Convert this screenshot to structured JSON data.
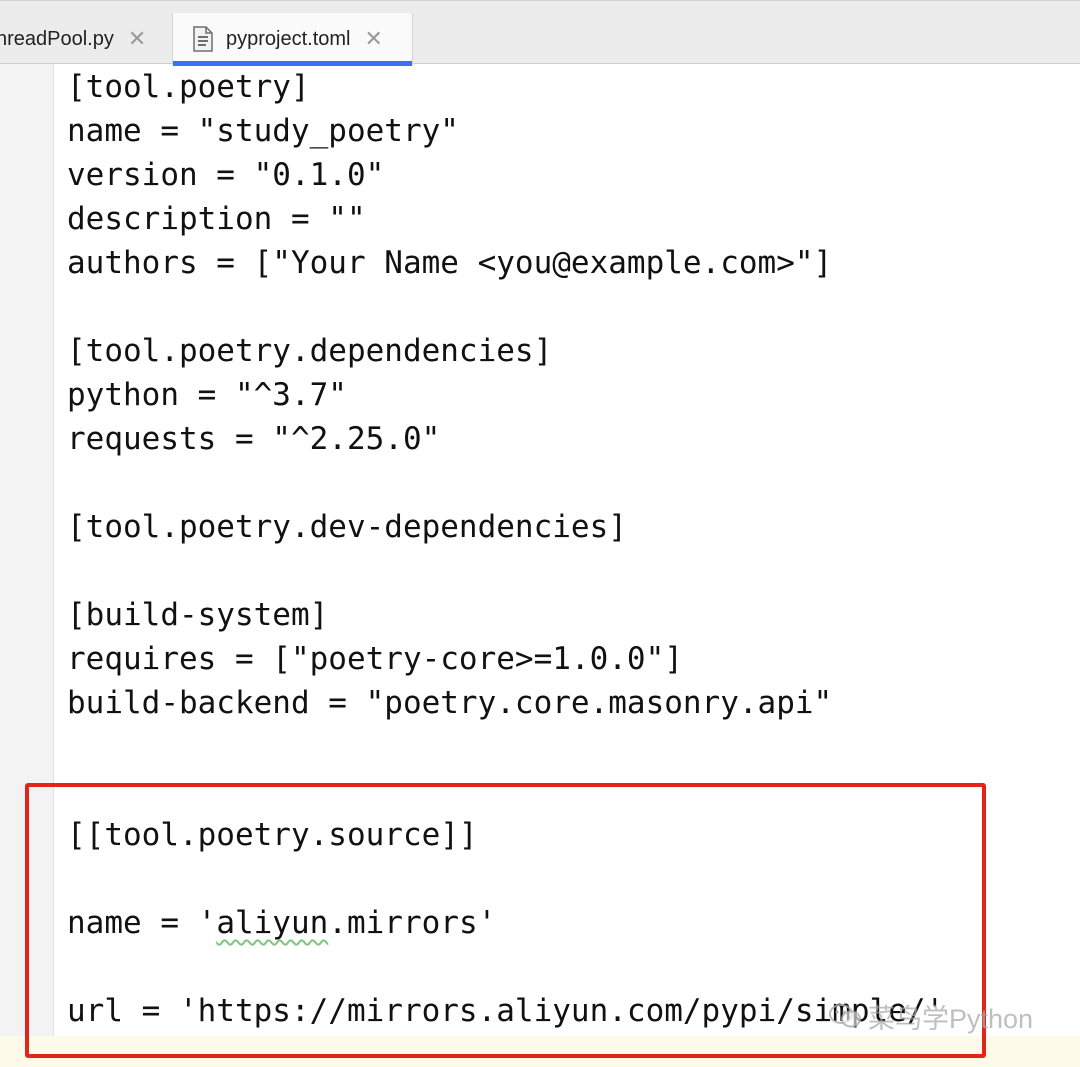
{
  "tabs": [
    {
      "label": "hreadPool.py",
      "active": false
    },
    {
      "label": "pyproject.toml",
      "active": true
    }
  ],
  "tab_close_glyph": "✕",
  "icons": {
    "file": "file-icon",
    "close": "close-icon",
    "watermark": "wechat-icon"
  },
  "code_lines": {
    "l1": "[tool.poetry]",
    "l2": "name = \"study_poetry\"",
    "l3": "version = \"0.1.0\"",
    "l4": "description = \"\"",
    "l5": "authors = [\"Your Name <you@example.com>\"]",
    "l6": "",
    "l7": "[tool.poetry.dependencies]",
    "l8": "python = \"^3.7\"",
    "l9": "requests = \"^2.25.0\"",
    "l10": "",
    "l11": "[tool.poetry.dev-dependencies]",
    "l12": "",
    "l13": "[build-system]",
    "l14": "requires = [\"poetry-core>=1.0.0\"]",
    "l15": "build-backend = \"poetry.core.masonry.api\"",
    "l16": "",
    "l17": "",
    "l18": "[[tool.poetry.source]]",
    "l19": "",
    "l20a": "name = '",
    "l20b": "aliyun",
    "l20c": ".mirrors'",
    "l21": "",
    "l22": "url = 'https://mirrors.aliyun.com/pypi/simple/'"
  },
  "watermark": "菜鸟学Python",
  "colors": {
    "accent": "#3574f0",
    "highlight_box": "#e3241b",
    "current_line": "#fdfaea"
  }
}
